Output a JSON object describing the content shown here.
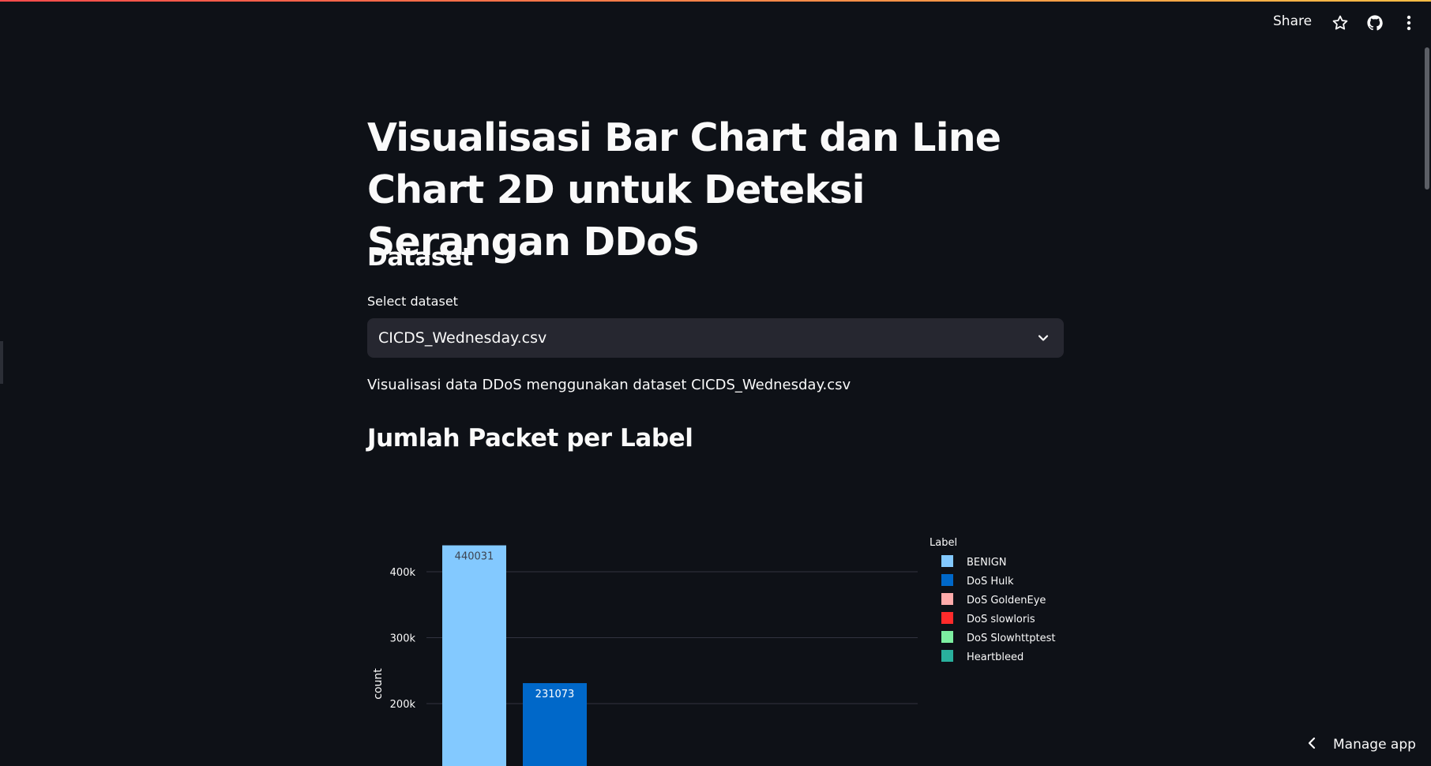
{
  "header": {
    "share_label": "Share"
  },
  "main": {
    "title": "Visualisasi Bar Chart dan Line Chart 2D untuk Deteksi Serangan DDoS",
    "dataset_heading": "Dataset",
    "select_label": "Select dataset",
    "select_value": "CICDS_Wednesday.csv",
    "caption": "Visualisasi data DDoS menggunakan dataset CICDS_Wednesday.csv",
    "chart_heading": "Jumlah Packet per Label"
  },
  "footer": {
    "manage_app_label": "Manage app"
  },
  "colors": {
    "background": "#0e1117",
    "select_bg": "#262730",
    "accent_gradient_start": "#ff4b4b",
    "accent_gradient_end": "#ffbd45"
  },
  "chart_data": {
    "type": "bar",
    "ylabel": "count",
    "legend_title": "Label",
    "legend_position": "top-right",
    "grid": true,
    "yticks": [
      200000,
      300000,
      400000
    ],
    "ytick_labels": [
      "200k",
      "300k",
      "400k"
    ],
    "categories": [
      "BENIGN",
      "DoS Hulk",
      "DoS GoldenEye",
      "DoS slowloris",
      "DoS Slowhttptest",
      "Heartbleed"
    ],
    "values": [
      440031,
      231073,
      null,
      null,
      null,
      null
    ],
    "value_labels": [
      "440031",
      "231073",
      "",
      "",
      "",
      ""
    ],
    "colors": [
      "#83c9ff",
      "#0068c9",
      "#ffabab",
      "#ff2b2b",
      "#7defa1",
      "#29b09d"
    ]
  }
}
